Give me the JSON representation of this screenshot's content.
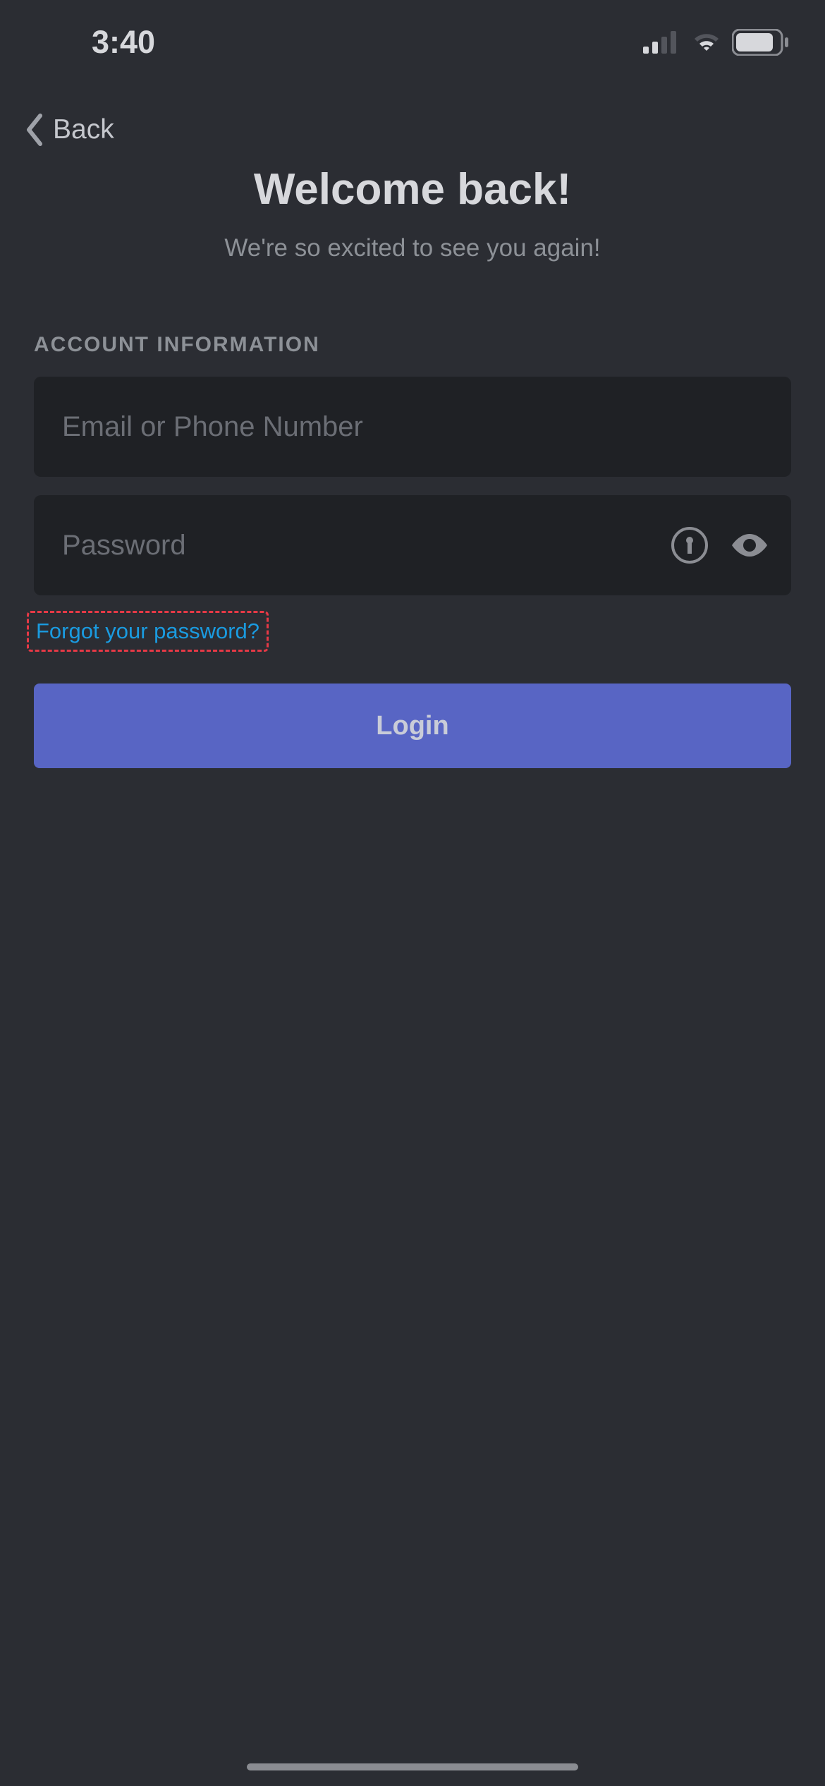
{
  "status": {
    "time": "3:40"
  },
  "nav": {
    "back": "Back"
  },
  "header": {
    "title": "Welcome back!",
    "subtitle": "We're so excited to see you again!"
  },
  "form": {
    "section_label": "ACCOUNT INFORMATION",
    "email_placeholder": "Email or Phone Number",
    "password_placeholder": "Password",
    "forgot_link": "Forgot your password?",
    "login_label": "Login"
  }
}
